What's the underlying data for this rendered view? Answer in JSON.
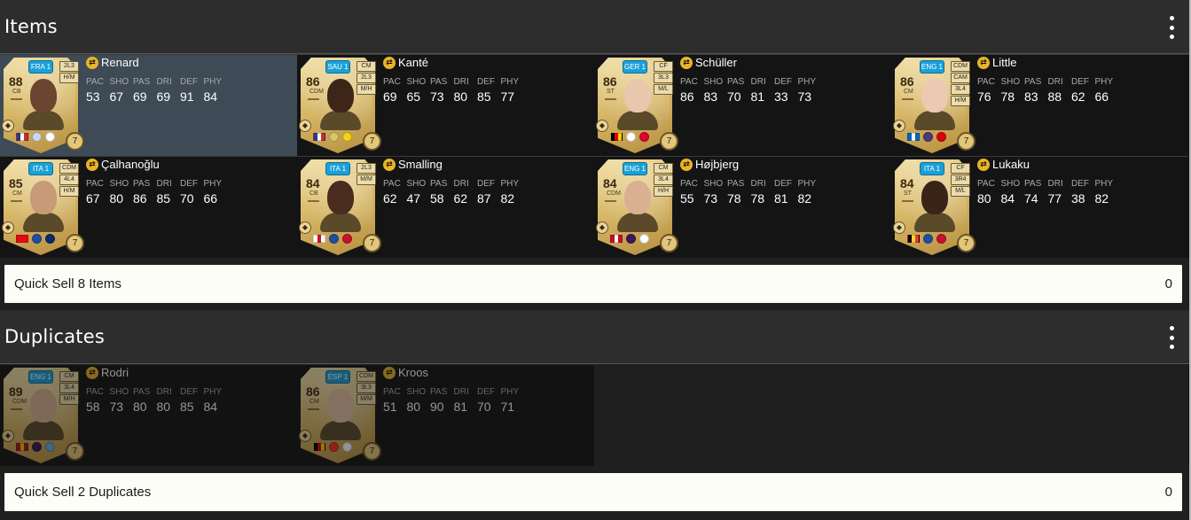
{
  "sections": [
    {
      "title": "Items",
      "menu_icon": "kebab-menu-icon",
      "quicksell": {
        "label": "Quick Sell 8 Items",
        "value": "0"
      },
      "players": [
        {
          "name": "Renard",
          "ovr": "88",
          "pos": "CB",
          "league": "FRA 1",
          "badges": [
            "2L3",
            "H/M"
          ],
          "stats": [
            "53",
            "67",
            "69",
            "69",
            "91",
            "84"
          ],
          "chem": "7",
          "selected": true,
          "skin": "#6b4530",
          "flag": [
            "#1f3c8f",
            "#ffffff",
            "#d52b1e"
          ],
          "crests": [
            "#cbd8ee",
            "#ffffff"
          ]
        },
        {
          "name": "Kanté",
          "ovr": "86",
          "pos": "CDM",
          "league": "SAU 1",
          "badges": [
            "CM",
            "2L3",
            "M/H"
          ],
          "stats": [
            "69",
            "65",
            "73",
            "80",
            "85",
            "77"
          ],
          "chem": "7",
          "selected": false,
          "skin": "#3d2518",
          "flag": [
            "#1f3c8f",
            "#ffffff",
            "#d52b1e"
          ],
          "crests": [
            "#d8c66a",
            "#f2d21b"
          ]
        },
        {
          "name": "Schüller",
          "ovr": "86",
          "pos": "ST",
          "league": "GER 1",
          "badges": [
            "CF",
            "3L3",
            "M/L"
          ],
          "stats": [
            "86",
            "83",
            "70",
            "81",
            "33",
            "73"
          ],
          "chem": "7",
          "selected": false,
          "skin": "#e8c7ad",
          "flag": [
            "#000000",
            "#dd0000",
            "#ffce00"
          ],
          "crests": [
            "#ffffff",
            "#dc052d"
          ]
        },
        {
          "name": "Little",
          "ovr": "86",
          "pos": "CM",
          "league": "ENG 1",
          "badges": [
            "CDM",
            "CAM",
            "3L4",
            "H/M"
          ],
          "stats": [
            "76",
            "78",
            "83",
            "88",
            "62",
            "66"
          ],
          "chem": "7",
          "selected": false,
          "skin": "#ecc9b0",
          "flag": [
            "#0065bd",
            "#ffffff",
            "#0065bd"
          ],
          "crests": [
            "#4a3a78",
            "#db0007"
          ]
        },
        {
          "name": "Çalhanoğlu",
          "ovr": "85",
          "pos": "CM",
          "league": "ITA 1",
          "badges": [
            "CDM",
            "4L4",
            "H/M"
          ],
          "stats": [
            "67",
            "80",
            "86",
            "85",
            "70",
            "66"
          ],
          "chem": "7",
          "selected": false,
          "skin": "#c89a78",
          "flag": [
            "#e30a17",
            "#e30a17",
            "#e30a17"
          ],
          "crests": [
            "#1f4fa0",
            "#0a2a6e"
          ]
        },
        {
          "name": "Smalling",
          "ovr": "84",
          "pos": "CB",
          "league": "ITA 1",
          "badges": [
            "2L3",
            "M/M"
          ],
          "stats": [
            "62",
            "47",
            "58",
            "62",
            "87",
            "82"
          ],
          "chem": "7",
          "selected": false,
          "skin": "#4a2c1e",
          "flag": [
            "#ffffff",
            "#ce1124",
            "#ffffff"
          ],
          "crests": [
            "#1f4fa0",
            "#c8102e"
          ]
        },
        {
          "name": "Højbjerg",
          "ovr": "84",
          "pos": "CDM",
          "league": "ENG 1",
          "badges": [
            "CM",
            "3L4",
            "H/H"
          ],
          "stats": [
            "55",
            "73",
            "78",
            "78",
            "81",
            "82"
          ],
          "chem": "7",
          "selected": false,
          "skin": "#d9b092",
          "flag": [
            "#c60c30",
            "#ffffff",
            "#c60c30"
          ],
          "crests": [
            "#3d195b",
            "#ffffff"
          ]
        },
        {
          "name": "Lukaku",
          "ovr": "84",
          "pos": "ST",
          "league": "ITA 1",
          "badges": [
            "CF",
            "3R4",
            "M/L"
          ],
          "stats": [
            "80",
            "84",
            "74",
            "77",
            "38",
            "82"
          ],
          "chem": "7",
          "selected": false,
          "skin": "#3a2418",
          "flag": [
            "#000000",
            "#fdda24",
            "#ef3340"
          ],
          "crests": [
            "#1f4fa0",
            "#c8102e"
          ]
        }
      ]
    },
    {
      "title": "Duplicates",
      "menu_icon": "kebab-menu-icon",
      "quicksell": {
        "label": "Quick Sell 2 Duplicates",
        "value": "0"
      },
      "players": [
        {
          "name": "Rodri",
          "ovr": "89",
          "pos": "CDM",
          "league": "ENG 1",
          "badges": [
            "CM",
            "3L4",
            "M/H"
          ],
          "stats": [
            "58",
            "73",
            "80",
            "80",
            "85",
            "84"
          ],
          "chem": "7",
          "selected": false,
          "skin": "#d8b294",
          "flag": [
            "#aa151b",
            "#f1bf00",
            "#aa151b"
          ],
          "crests": [
            "#3d195b",
            "#6cabdd"
          ]
        },
        {
          "name": "Kroos",
          "ovr": "86",
          "pos": "CM",
          "league": "ESP 1",
          "badges": [
            "CDM",
            "3L3",
            "M/M"
          ],
          "stats": [
            "51",
            "80",
            "90",
            "81",
            "70",
            "71"
          ],
          "chem": "7",
          "selected": false,
          "skin": "#e2c0a4",
          "flag": [
            "#000000",
            "#dd0000",
            "#ffce00"
          ],
          "crests": [
            "#ee3524",
            "#ffffff"
          ]
        }
      ]
    }
  ],
  "stat_labels": [
    "PAC",
    "SHO",
    "PAS",
    "DRI",
    "DEF",
    "PHY"
  ]
}
